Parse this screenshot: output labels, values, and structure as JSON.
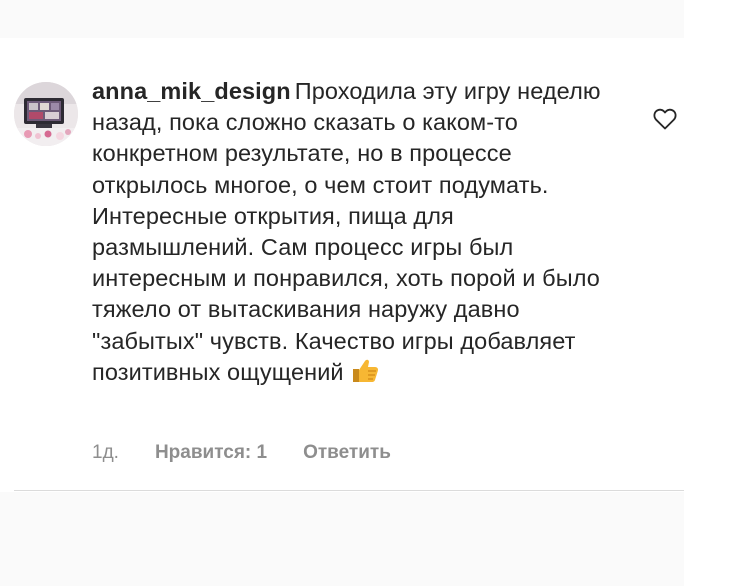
{
  "comment": {
    "username": "anna_mik_design",
    "text": "Проходила эту игру неделю назад, пока сложно сказать о каком-то конкретном результате, но в процессе открылось многое, о чем стоит подумать. Интересные открытия, пища для размышлений. Сам процесс игры был интересным и понравился, хоть порой и было тяжело от вытаскивания наружу давно \"забытых\" чувств. Качество игры добавляет позитивных ощущений",
    "emoji_icon": "thumbs-up-icon",
    "age": "1д.",
    "likes_label": "Нравится: 1",
    "reply_label": "Ответить",
    "like_icon": "heart-outline-icon"
  },
  "colors": {
    "text": "#262626",
    "meta": "#8e8e8e",
    "divider": "#dbdbdb",
    "band": "#fafafa"
  }
}
